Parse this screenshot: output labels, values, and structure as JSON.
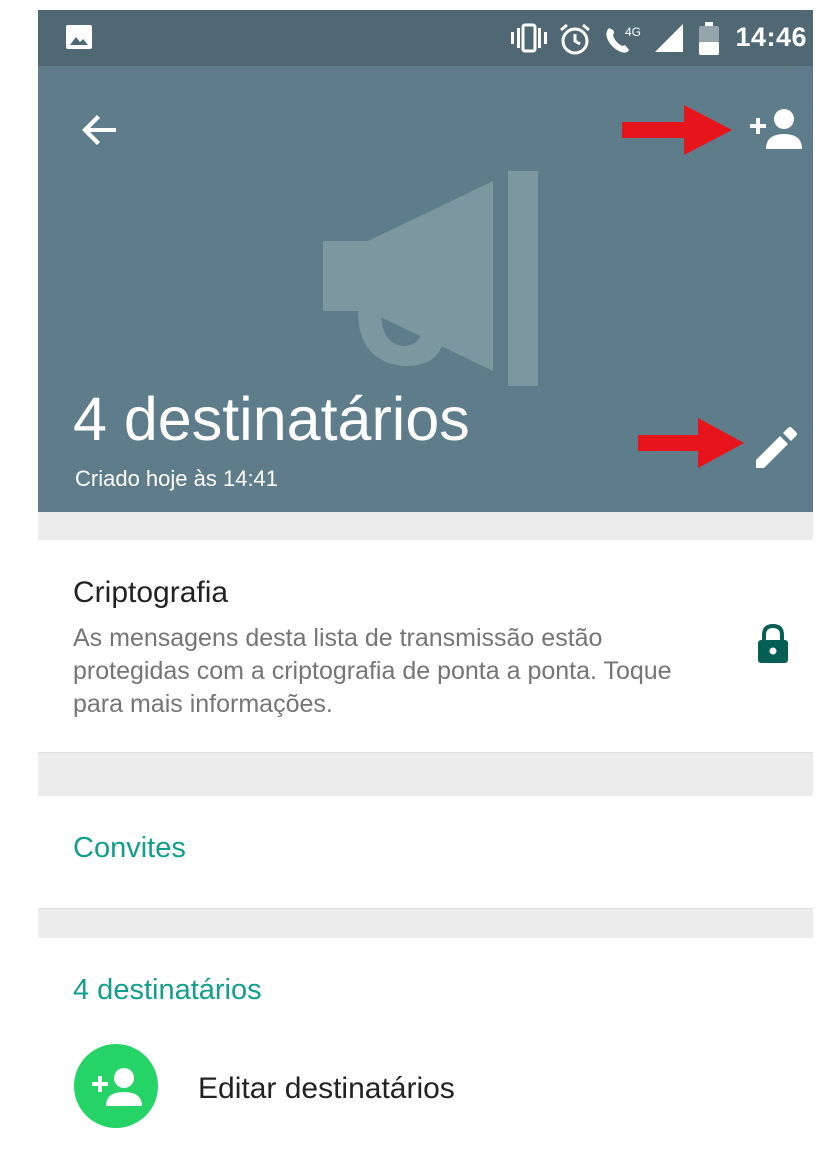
{
  "status_bar": {
    "time": "14:46",
    "icons": [
      "image-icon",
      "vibrate-icon",
      "alarm-icon",
      "volte-4g-icon",
      "signal-icon",
      "battery-icon"
    ]
  },
  "header": {
    "title": "4 destinatários",
    "subtitle": "Criado hoje às 14:41",
    "background_color": "#5e7c8a",
    "background_icon": "megaphone-icon",
    "actions": [
      "back-arrow-icon",
      "add-person-icon",
      "pencil-icon"
    ]
  },
  "encryption": {
    "title": "Criptografia",
    "description": "As mensagens desta lista de transmissão estão protegidas com a criptografia de ponta a ponta. Toque para mais informações.",
    "icon": "lock-icon",
    "icon_color": "#075e54"
  },
  "invites": {
    "label": "Convites"
  },
  "recipients": {
    "header": "4 destinatários",
    "edit_label": "Editar destinatários",
    "edit_icon": "add-person-icon",
    "accent_color": "#25d366"
  },
  "colors": {
    "accent_text": "#119e8a",
    "annotation_arrow": "#e8141c"
  }
}
